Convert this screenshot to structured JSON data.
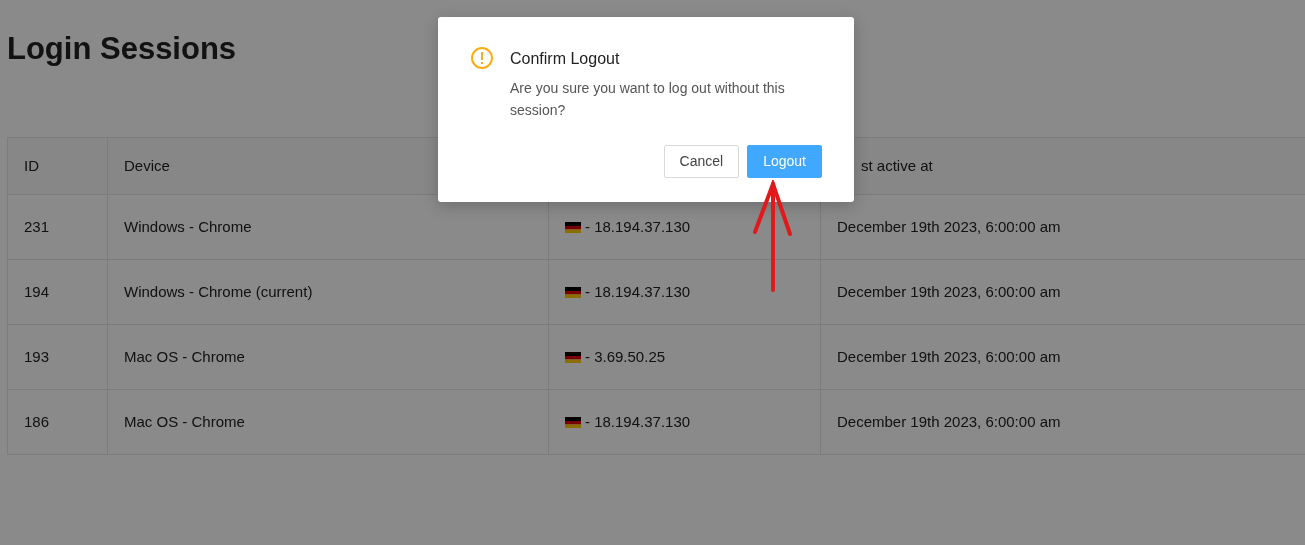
{
  "page": {
    "title": "Login Sessions"
  },
  "table": {
    "columns": [
      "ID",
      "Device",
      null,
      "st active at"
    ],
    "rows": [
      {
        "id": "231",
        "device": "Windows - Chrome",
        "ip": "- 18.194.37.130",
        "last_active": "December 19th 2023, 6:00:00 am"
      },
      {
        "id": "194",
        "device": "Windows - Chrome (current)",
        "ip": "- 18.194.37.130",
        "last_active": "December 19th 2023, 6:00:00 am"
      },
      {
        "id": "193",
        "device": "Mac OS - Chrome",
        "ip": "- 3.69.50.25",
        "last_active": "December 19th 2023, 6:00:00 am"
      },
      {
        "id": "186",
        "device": "Mac OS - Chrome",
        "ip": "- 18.194.37.130",
        "last_active": "December 19th 2023, 6:00:00 am"
      }
    ]
  },
  "dialog": {
    "title": "Confirm Logout",
    "message": "Are you sure you want to log out without this session?",
    "buttons": [
      {
        "label": "Cancel",
        "kind": "default"
      },
      {
        "label": "Logout",
        "kind": "primary"
      }
    ]
  }
}
